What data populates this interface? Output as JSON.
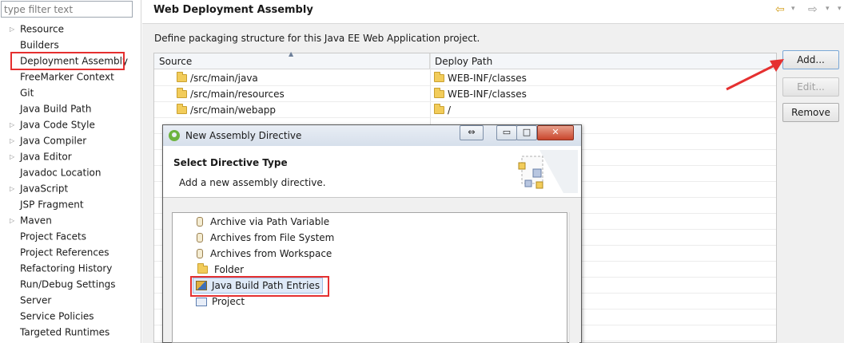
{
  "sidebar": {
    "filter_placeholder": "type filter text",
    "items": [
      {
        "label": "Resource",
        "expandable": true
      },
      {
        "label": "Builders",
        "expandable": false
      },
      {
        "label": "Deployment Assembly",
        "expandable": false,
        "highlighted": true
      },
      {
        "label": "FreeMarker Context",
        "expandable": false
      },
      {
        "label": "Git",
        "expandable": false
      },
      {
        "label": "Java Build Path",
        "expandable": false
      },
      {
        "label": "Java Code Style",
        "expandable": true
      },
      {
        "label": "Java Compiler",
        "expandable": true
      },
      {
        "label": "Java Editor",
        "expandable": true
      },
      {
        "label": "Javadoc Location",
        "expandable": false
      },
      {
        "label": "JavaScript",
        "expandable": true
      },
      {
        "label": "JSP Fragment",
        "expandable": false
      },
      {
        "label": "Maven",
        "expandable": true
      },
      {
        "label": "Project Facets",
        "expandable": false
      },
      {
        "label": "Project References",
        "expandable": false
      },
      {
        "label": "Refactoring History",
        "expandable": false
      },
      {
        "label": "Run/Debug Settings",
        "expandable": false
      },
      {
        "label": "Server",
        "expandable": false
      },
      {
        "label": "Service Policies",
        "expandable": false
      },
      {
        "label": "Targeted Runtimes",
        "expandable": false
      }
    ]
  },
  "page": {
    "title": "Web Deployment Assembly",
    "description": "Define packaging structure for this Java EE Web Application project."
  },
  "table": {
    "headers": {
      "source": "Source",
      "deploy_path": "Deploy Path"
    },
    "rows": [
      {
        "source": "/src/main/java",
        "deploy_path": "WEB-INF/classes"
      },
      {
        "source": "/src/main/resources",
        "deploy_path": "WEB-INF/classes"
      },
      {
        "source": "/src/main/webapp",
        "deploy_path": "/"
      }
    ]
  },
  "buttons": {
    "add": "Add...",
    "edit": "Edit...",
    "remove": "Remove"
  },
  "dialog": {
    "title": "New Assembly Directive",
    "header_title": "Select Directive Type",
    "header_description": "Add a new assembly directive.",
    "window_controls": {
      "restore": "⇔",
      "minimize": "▭",
      "maximize": "□",
      "close": "✕"
    },
    "directives": [
      {
        "label": "Archive via Path Variable",
        "icon": "jar-icon"
      },
      {
        "label": "Archives from File System",
        "icon": "jar-icon"
      },
      {
        "label": "Archives from Workspace",
        "icon": "jar-icon"
      },
      {
        "label": "Folder",
        "icon": "folder-icon"
      },
      {
        "label": "Java Build Path Entries",
        "icon": "build-path-icon",
        "selected": true
      },
      {
        "label": "Project",
        "icon": "project-icon"
      }
    ]
  },
  "colors": {
    "highlight_red": "#e53030",
    "folder_yellow": "#f2cc5a",
    "selection_blue": "#dfeaf8"
  }
}
